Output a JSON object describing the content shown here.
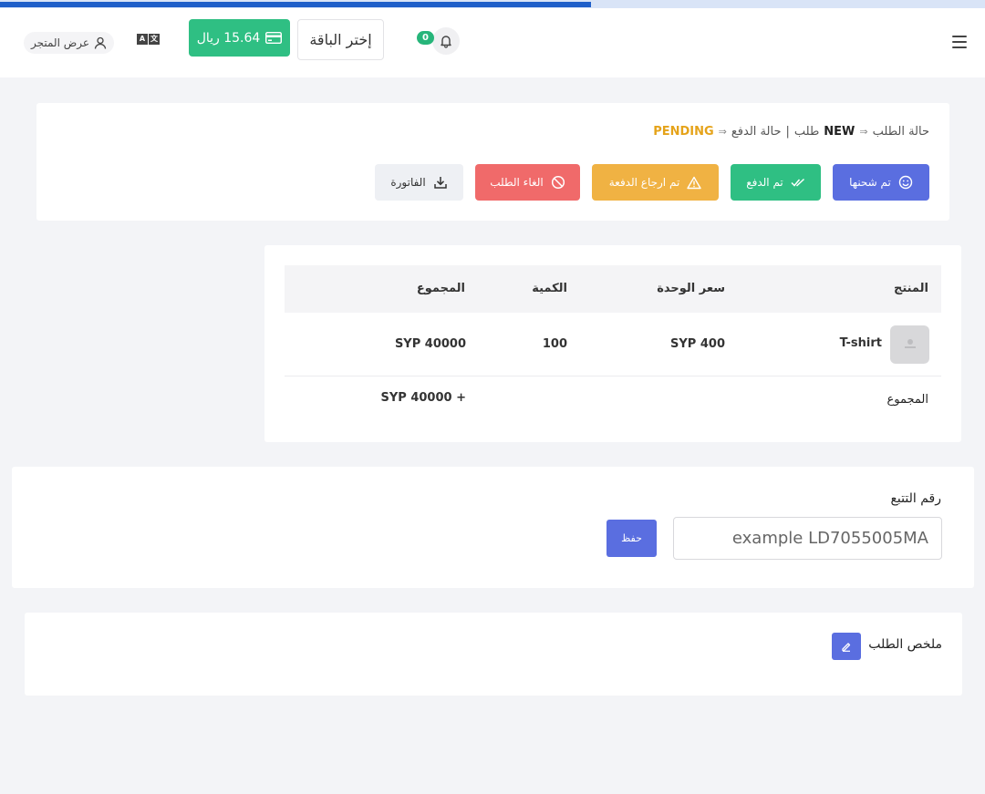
{
  "progress": 0.6,
  "header": {
    "notifications_count": "0",
    "choose_package": "إختر الباقة",
    "balance": "15.64 ريال",
    "view_store": "عرض المتجر",
    "icons": [
      "menu-icon",
      "bell-icon",
      "credit-card-icon",
      "translate-icon",
      "user-icon"
    ]
  },
  "order_status": {
    "label_order_status": "حالة الطلب",
    "order_status_value": "NEW",
    "label_order": "طلب",
    "separator": "|",
    "label_payment_status": "حالة الدفع",
    "payment_status_value": "PENDING",
    "arrow": "⇒",
    "actions": {
      "shipped": "تم شحنها",
      "paid": "تم الدفع",
      "refunded": "تم ارجاع الدفعة",
      "cancel": "الغاء الطلب",
      "invoice": "الفاتورة"
    }
  },
  "products_table": {
    "columns": [
      "المنتج",
      "سعر الوحدة",
      "الكمية",
      "المجموع"
    ],
    "rows": [
      {
        "product": "T-shirt",
        "unit_price": "SYP 400",
        "quantity": "100",
        "total": "SYP 40000"
      }
    ],
    "footer_label": "المجموع",
    "footer_total": "SYP 40000 +"
  },
  "tracking": {
    "label": "رقم التتبع",
    "placeholder": "example LD7055005MA",
    "save": "حفظ"
  },
  "summary": {
    "title": "ملخص الطلب"
  },
  "colors": {
    "primary": "#5a6ee0",
    "success": "#2fbf83",
    "warning": "#f0b243",
    "danger": "#f06a6a",
    "pending": "#e5a31a"
  }
}
